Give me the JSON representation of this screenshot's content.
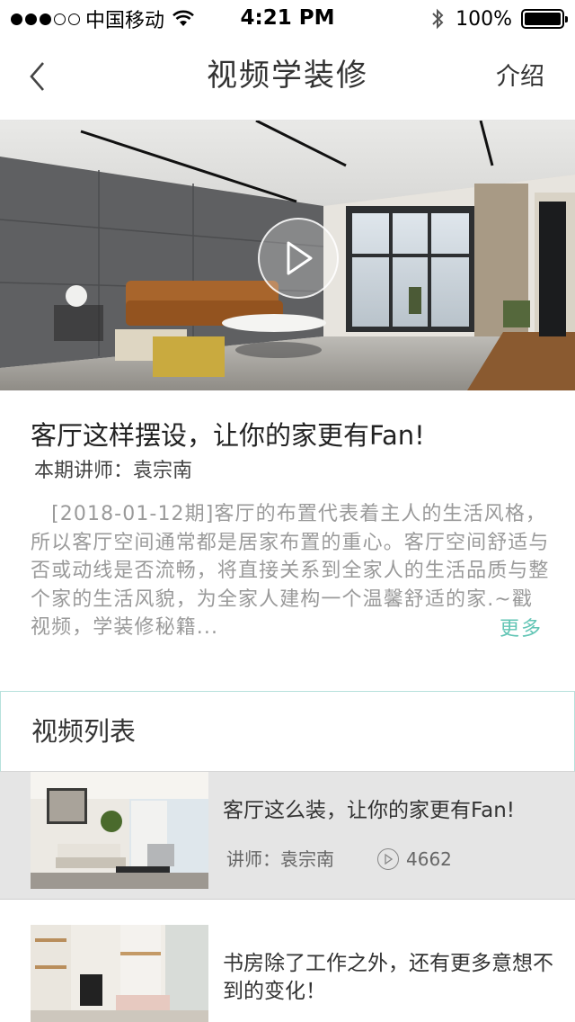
{
  "status_bar": {
    "carrier": "中国移动",
    "time": "4:21 PM",
    "battery": "100%"
  },
  "nav": {
    "title": "视频学装修",
    "right_label": "介绍"
  },
  "lesson": {
    "title": "客厅这样摆设，让你的家更有Fan!",
    "lecturer": "本期讲师：袁宗南",
    "description": "[2018-01-12期]客厅的布置代表着主人的生活风格，所以客厅空间通常都是居家布置的重心。客厅空间舒适与否或动线是否流畅，将直接关系到全家人的生活品质与整个家的生活风貌，为全家人建构一个温馨舒适的家.~戳视频，学装修秘籍...",
    "more_label": "更多"
  },
  "video_list": {
    "header": "视频列表",
    "items": [
      {
        "title": "客厅这么装，让你的家更有Fan!",
        "lecturer": "讲师：袁宗南",
        "views": "4662"
      },
      {
        "title": "书房除了工作之外，还有更多意想不到的变化！"
      }
    ]
  }
}
